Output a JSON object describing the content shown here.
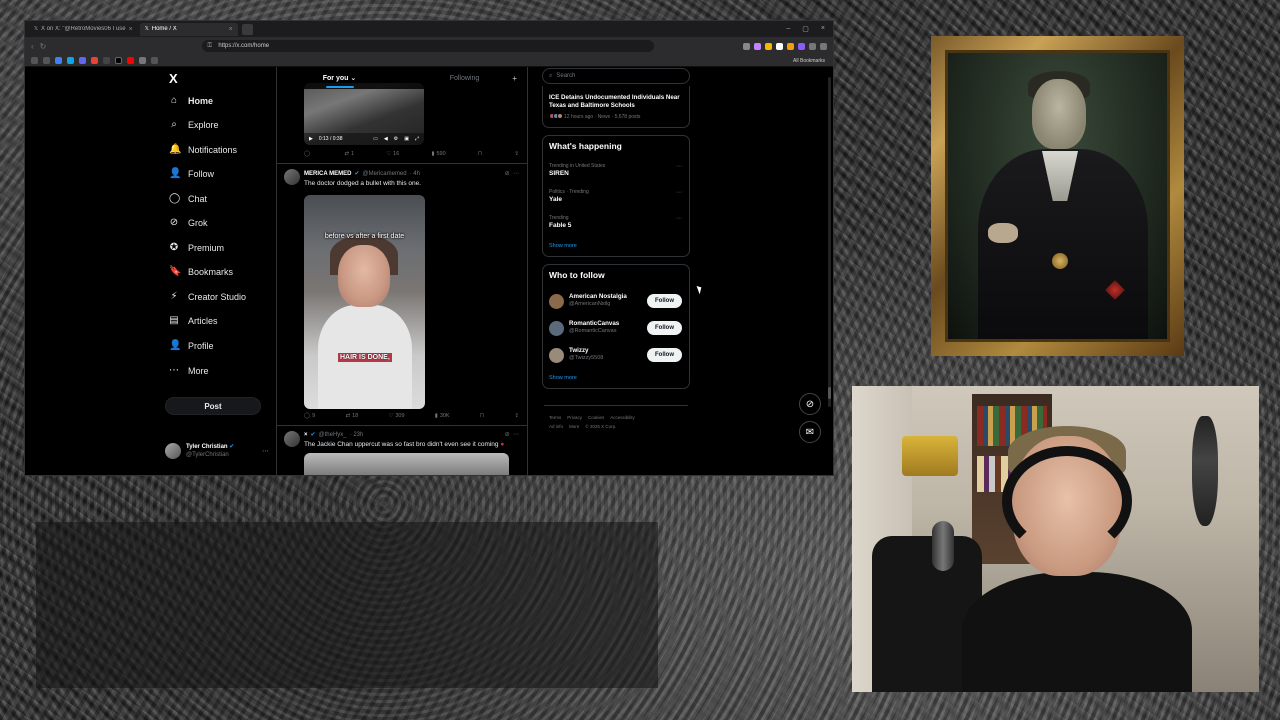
{
  "browser": {
    "tabs": [
      {
        "label": "X on X: \"@RetroMovies06 I use",
        "active": false
      },
      {
        "label": "Home / X",
        "active": true
      }
    ],
    "url": "https://x.com/home",
    "bookmarks_label": "All Bookmarks"
  },
  "leftnav": {
    "logo": "X",
    "items": [
      {
        "label": "Home",
        "icon": "home-icon",
        "glyph": "⌂"
      },
      {
        "label": "Explore",
        "icon": "search-icon",
        "glyph": "⌕"
      },
      {
        "label": "Notifications",
        "icon": "bell-icon",
        "glyph": "🔔"
      },
      {
        "label": "Follow",
        "icon": "person-plus-icon",
        "glyph": "👤"
      },
      {
        "label": "Chat",
        "icon": "chat-icon",
        "glyph": "◯"
      },
      {
        "label": "Grok",
        "icon": "grok-icon",
        "glyph": "⊘"
      },
      {
        "label": "Premium",
        "icon": "premium-icon",
        "glyph": "✪"
      },
      {
        "label": "Bookmarks",
        "icon": "bookmark-icon",
        "glyph": "🔖"
      },
      {
        "label": "Creator Studio",
        "icon": "creator-studio-icon",
        "glyph": "⚡"
      },
      {
        "label": "Articles",
        "icon": "articles-icon",
        "glyph": "▤"
      },
      {
        "label": "Profile",
        "icon": "profile-icon",
        "glyph": "👤"
      },
      {
        "label": "More",
        "icon": "more-icon",
        "glyph": "⋯"
      }
    ],
    "post_label": "Post",
    "account": {
      "name": "Tyler Christian",
      "handle": "@TylerChristian"
    }
  },
  "feed": {
    "tabs": [
      "For you",
      "Following"
    ],
    "tweet1": {
      "video_time": "0:13 / 0:38",
      "actions": {
        "replies": "",
        "retweets": "1",
        "likes": "16",
        "views": "590"
      }
    },
    "tweet2": {
      "name": "MERICA MEMED",
      "handle": "@Mericamemed",
      "time": "· 4h",
      "text": "The doctor dodged a bullet with this one.",
      "caption_top": "before vs after a first date",
      "caption_bottom": "HAIR IS DONE,",
      "actions": {
        "replies": "9",
        "retweets": "18",
        "likes": "309",
        "views": "30K"
      }
    },
    "tweet3": {
      "name": "×",
      "handle": "@theHyx_",
      "time": "· 23h",
      "text": "The Jackie Chan uppercut was so fast bro didn't even see it coming"
    }
  },
  "rightcol": {
    "search_placeholder": "Search",
    "news": {
      "title": "ICE Detains Undocumented Individuals Near Texas and Baltimore Schools",
      "meta": "12 hours ago · News · 5,678 posts"
    },
    "whats_happening": {
      "title": "What's happening",
      "trends": [
        {
          "meta": "Trending in United States",
          "name": "SIREN"
        },
        {
          "meta": "Politics · Trending",
          "name": "Yale"
        },
        {
          "meta": "Trending",
          "name": "Fable 5"
        }
      ],
      "show_more": "Show more"
    },
    "who_to_follow": {
      "title": "Who to follow",
      "accounts": [
        {
          "name": "American Nostalgia",
          "handle": "@AmericanNstlg",
          "color": "#8a6a4a"
        },
        {
          "name": "RomanticCanvas",
          "handle": "@RomanticCanvas",
          "color": "#5a6a7a"
        },
        {
          "name": "Twizzy",
          "handle": "@Twizzy5508",
          "color": "#9a8a7a"
        }
      ],
      "follow_label": "Follow",
      "show_more": "Show more"
    },
    "footer": {
      "row1": [
        "Terms",
        "Privacy",
        "Cookies",
        "Accessibility"
      ],
      "row2": [
        "Ad info",
        "More",
        "© 2025 X Corp."
      ]
    }
  }
}
